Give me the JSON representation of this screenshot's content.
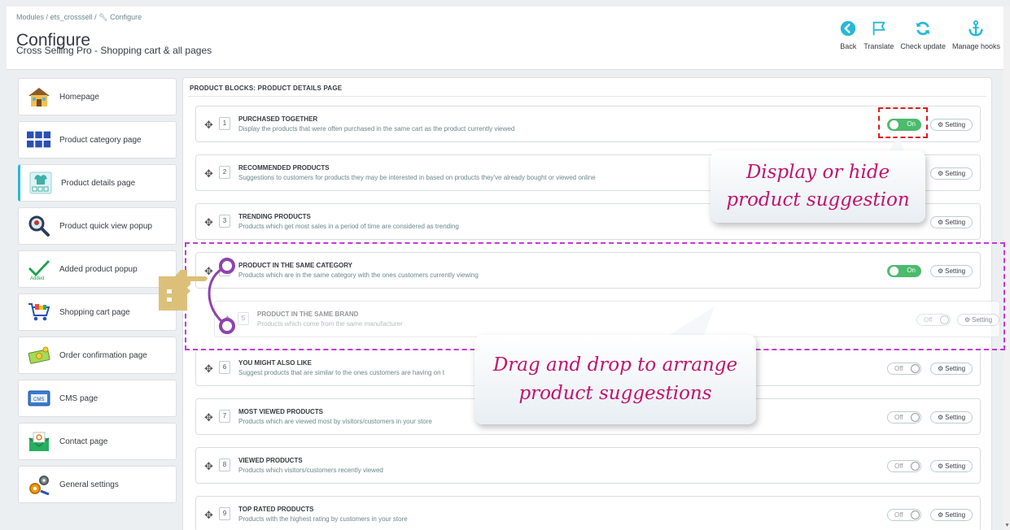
{
  "breadcrumb": {
    "items": [
      "Modules",
      "ets_crosssell",
      "Configure"
    ],
    "separator": "/"
  },
  "header": {
    "title": "Configure",
    "subtitle": "Cross Selling Pro - Shopping cart & all pages"
  },
  "toolbar": [
    {
      "label": "Back",
      "icon": "back-icon"
    },
    {
      "label": "Translate",
      "icon": "flag-icon"
    },
    {
      "label": "Check update",
      "icon": "refresh-icon"
    },
    {
      "label": "Manage hooks",
      "icon": "anchor-icon"
    }
  ],
  "sidebar": {
    "items": [
      {
        "label": "Homepage",
        "icon": "house-icon"
      },
      {
        "label": "Product category page",
        "icon": "grid-icon"
      },
      {
        "label": "Product details page",
        "icon": "product-details-icon",
        "active": true
      },
      {
        "label": "Product quick view popup",
        "icon": "magnifier-icon"
      },
      {
        "label": "Added product popup",
        "icon": "checkmark-icon"
      },
      {
        "label": "Shopping cart page",
        "icon": "cart-icon"
      },
      {
        "label": "Order confirmation page",
        "icon": "money-icon"
      },
      {
        "label": "CMS page",
        "icon": "cms-icon"
      },
      {
        "label": "Contact page",
        "icon": "envelope-icon"
      },
      {
        "label": "General settings",
        "icon": "gears-icon"
      }
    ]
  },
  "panel": {
    "title": "PRODUCT BLOCKS: PRODUCT DETAILS PAGE",
    "setting_label": "Setting",
    "on_label": "On",
    "off_label": "Off",
    "blocks": [
      {
        "num": "1",
        "title": "PURCHASED TOGETHER",
        "desc": "Display the products that were often purchased in the same cart as the product currently viewed",
        "enabled": true
      },
      {
        "num": "2",
        "title": "RECOMMENDED PRODUCTS",
        "desc": "Suggestions to customers for products they may be interested in based on products they've already bought or viewed online",
        "enabled": false
      },
      {
        "num": "3",
        "title": "TRENDING PRODUCTS",
        "desc": "Products which get most sales in a period of time are considered as trending",
        "enabled": false
      },
      {
        "num": "4",
        "title": "PRODUCT IN THE SAME CATEGORY",
        "desc": "Products which are in the same category with the ones customers currently viewing",
        "enabled": true
      },
      {
        "num": "6",
        "title": "YOU MIGHT ALSO LIKE",
        "desc": "Suggest products that are similar to the ones customers are having on t",
        "enabled": false
      },
      {
        "num": "7",
        "title": "MOST VIEWED PRODUCTS",
        "desc": "Products which are viewed most by visitors/customers in your store",
        "enabled": false
      },
      {
        "num": "8",
        "title": "VIEWED PRODUCTS",
        "desc": "Products which visitors/customers recently viewed",
        "enabled": false
      },
      {
        "num": "9",
        "title": "TOP RATED PRODUCTS",
        "desc": "Products with the highest rating by customers in your store",
        "enabled": false
      }
    ],
    "dragging_block": {
      "num": "5",
      "title": "PRODUCT IN THE SAME BRAND",
      "desc": "Products which come from the same manufacturer",
      "enabled": false
    }
  },
  "annotations": {
    "callout_toggle": [
      "Display or hide",
      "product suggestion"
    ],
    "callout_drag": [
      "Drag and drop to arrange",
      "product suggestions"
    ]
  },
  "colors": {
    "accent": "#25b9d7",
    "on": "#4cbb6c",
    "callout_text": "#c0146e",
    "red_dash": "#d81b1b",
    "pink_dash": "#c23ad6"
  }
}
